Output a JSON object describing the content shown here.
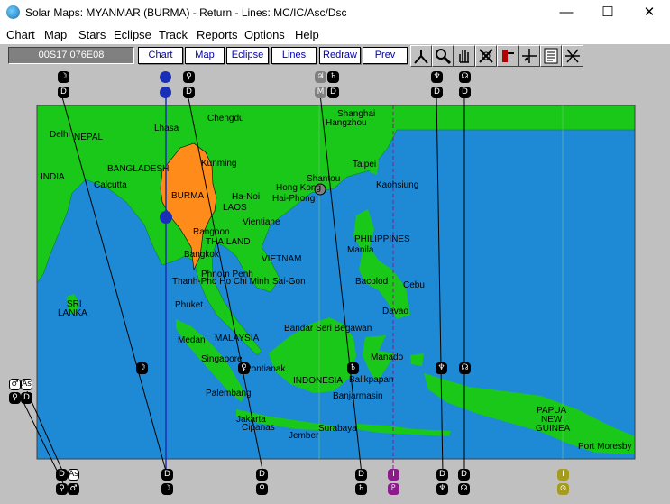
{
  "window": {
    "title": "Solar Maps: MYANMAR (BURMA) - Return - Lines: MC/IC/Asc/Dsc",
    "minimize": "—",
    "maximize": "☐",
    "close": "✕"
  },
  "menu": [
    "Chart",
    "Map",
    "Stars",
    "Eclipse",
    "Track",
    "Reports",
    "Options",
    "Help"
  ],
  "toolbar": {
    "coords": "00S17  076E08",
    "buttons": [
      "Chart",
      "Map",
      "Eclipse",
      "Lines",
      "Redraw",
      "Prev"
    ],
    "tools": [
      "compass-icon",
      "zoom-icon",
      "pan-hand-icon",
      "no-symbol-icon",
      "pointer-icon",
      "crosshair-icon",
      "notes-icon",
      "cross-lines-icon"
    ]
  },
  "map": {
    "colors": {
      "ocean": "#1e8ad6",
      "land": "#19c819",
      "highlight": "#ff8c1a",
      "line": "#000000",
      "sun_line": "#1a2fb8",
      "pluto_line": "#8b1a8b"
    },
    "places": [
      "Delhi",
      "NEPAL",
      "Lhasa",
      "Chengdu",
      "Shanghai",
      "Hangzhou",
      "INDIA",
      "BANGLADESH",
      "Kunming",
      "Taipei",
      "Calcutta",
      "BURMA",
      "Ha-Noi",
      "Hong Kong",
      "Shantou",
      "Kaohsiung",
      "Hai-Phong",
      "LAOS",
      "Vientiane",
      "Rangoon",
      "THAILAND",
      "PHILIPPINES",
      "Manila",
      "Bangkok",
      "VIETNAM",
      "Phnom Penh",
      "Thanh-Pho Ho Chi Minh",
      "Sai-Gon",
      "Bacolod",
      "Cebu",
      "SRI",
      "LANKA",
      "Phuket",
      "Davao",
      "Bandar Seri Begawan",
      "Medan",
      "MALAYSIA",
      "Manado",
      "Singapore",
      "Pontianak",
      "INDONESIA",
      "Balikpapan",
      "Palembang",
      "Banjarmasin",
      "PAPUA",
      "NEW",
      "GUINEA",
      "Jakarta",
      "Cipanas",
      "Surabaya",
      "Jember",
      "Port Moresby"
    ],
    "top_glyphs": [
      "☽",
      "D",
      "☉",
      "☉",
      "♀",
      "D",
      "♃",
      "♄",
      "M",
      "D",
      "♆",
      "D",
      "☊",
      "D"
    ],
    "mid_glyphs": [
      "☽",
      "♀",
      "♄",
      "♆",
      "☊",
      "♃",
      "☉"
    ],
    "left_glyphs": [
      "♂",
      "As",
      "♀",
      "D"
    ],
    "bottom_glyphs": [
      "D",
      "As",
      "♀",
      "♂",
      "D",
      "☽",
      "D",
      "♀",
      "D",
      "♄",
      "I",
      "♇",
      "D",
      "♆",
      "D",
      "☊",
      "I",
      "⊙"
    ]
  }
}
